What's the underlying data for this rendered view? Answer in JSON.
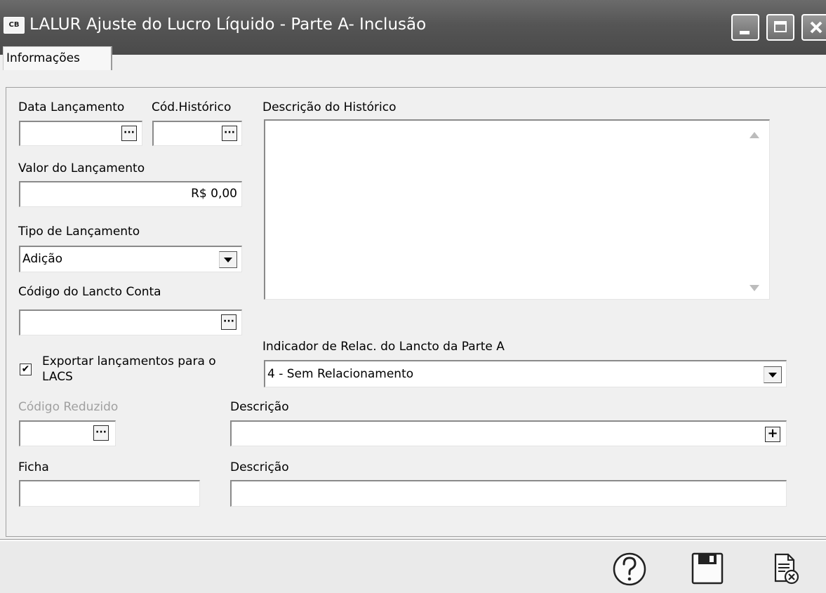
{
  "window": {
    "icon_label": "CB",
    "title": "LALUR Ajuste do Lucro Líquido - Parte A- Inclusão"
  },
  "tabs": [
    {
      "label": "Informações",
      "active": true
    }
  ],
  "form": {
    "data_lancamento": {
      "label": "Data Lançamento",
      "value": ""
    },
    "cod_historico": {
      "label": "Cód.Histórico",
      "value": ""
    },
    "descricao_historico": {
      "label": "Descrição do Histórico",
      "value": ""
    },
    "valor_lancamento": {
      "label": "Valor do Lançamento",
      "value": "R$ 0,00"
    },
    "tipo_lancamento": {
      "label": "Tipo de Lançamento",
      "value": "Adição"
    },
    "codigo_lancto_conta": {
      "label": "Código do Lancto Conta",
      "value": ""
    },
    "exportar": {
      "label_line1": "Exportar lançamentos para o",
      "label_line2": "LACS",
      "checked": true,
      "check_glyph": "✔"
    },
    "indicador": {
      "label": "Indicador de Relac. do Lancto da Parte A",
      "value": "4 - Sem Relacionamento"
    },
    "codigo_reduzido": {
      "label": "Código Reduzido",
      "value": "",
      "disabled": true
    },
    "descricao_reduzido": {
      "label": "Descrição",
      "value": ""
    },
    "ficha": {
      "label": "Ficha",
      "value": ""
    },
    "descricao_ficha": {
      "label": "Descrição",
      "value": ""
    },
    "ellipsis": "···",
    "plus": "+"
  },
  "footer": {
    "help_icon": "help-icon",
    "save_icon": "save-icon",
    "cancel_icon": "cancel-document-icon"
  },
  "colors": {
    "titlebar": "#555555",
    "panel": "#f0f0f0",
    "disabled_text": "#a0a0a0"
  }
}
